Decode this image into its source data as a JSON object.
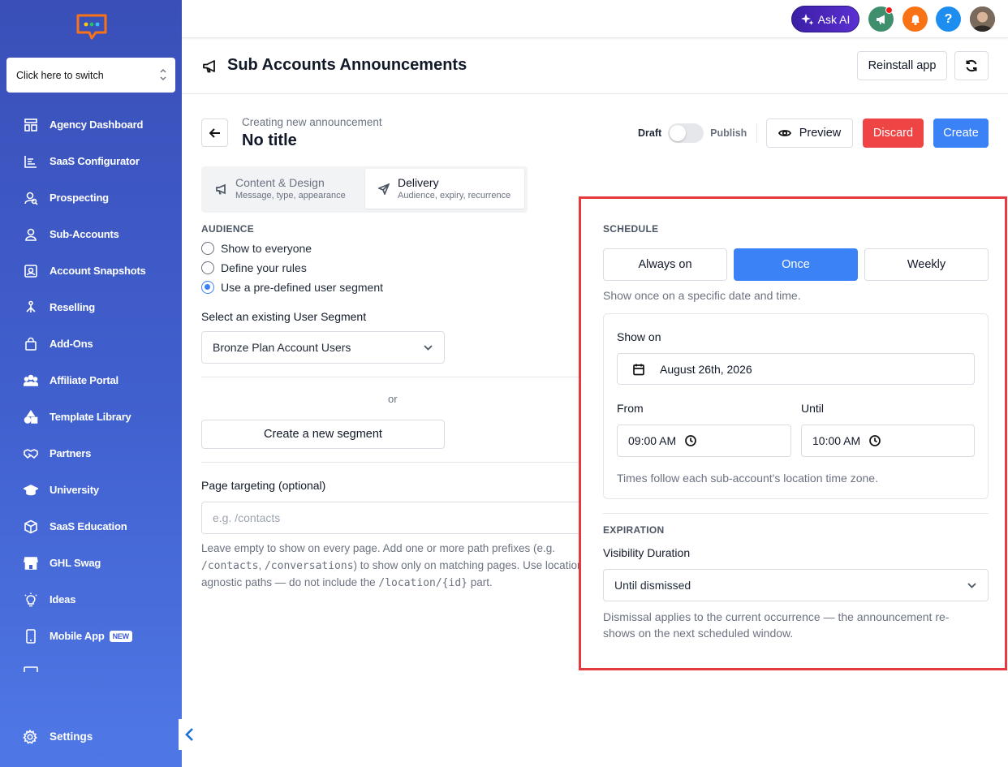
{
  "sidebar": {
    "switcher": "Click here to switch",
    "items": [
      {
        "label": "Agency Dashboard",
        "icon": "dashboard-icon"
      },
      {
        "label": "SaaS Configurator",
        "icon": "chart-icon"
      },
      {
        "label": "Prospecting",
        "icon": "prospecting-icon"
      },
      {
        "label": "Sub-Accounts",
        "icon": "user-icon"
      },
      {
        "label": "Account Snapshots",
        "icon": "snapshot-icon"
      },
      {
        "label": "Reselling",
        "icon": "reselling-icon"
      },
      {
        "label": "Add-Ons",
        "icon": "bag-icon"
      },
      {
        "label": "Affiliate Portal",
        "icon": "users-icon"
      },
      {
        "label": "Template Library",
        "icon": "shapes-icon"
      },
      {
        "label": "Partners",
        "icon": "handshake-icon"
      },
      {
        "label": "University",
        "icon": "graduation-icon"
      },
      {
        "label": "SaaS Education",
        "icon": "cube-icon"
      },
      {
        "label": "GHL Swag",
        "icon": "store-icon"
      },
      {
        "label": "Ideas",
        "icon": "bulb-icon"
      },
      {
        "label": "Mobile App",
        "icon": "mobile-icon",
        "badge": "NEW"
      }
    ],
    "settings": "Settings"
  },
  "topbar": {
    "ask_ai": "Ask AI",
    "help": "?"
  },
  "page": {
    "title": "Sub Accounts Announcements",
    "reinstall": "Reinstall app"
  },
  "editor": {
    "subtitle": "Creating new announcement",
    "title": "No title",
    "draft": "Draft",
    "publish": "Publish",
    "preview": "Preview",
    "discard": "Discard",
    "create": "Create"
  },
  "tabs": [
    {
      "label": "Content & Design",
      "sub": "Message, type, appearance"
    },
    {
      "label": "Delivery",
      "sub": "Audience, expiry, recurrence"
    }
  ],
  "audience": {
    "label": "AUDIENCE",
    "options": [
      "Show to everyone",
      "Define your rules",
      "Use a pre-defined user segment"
    ],
    "selected_index": 2,
    "segment_label": "Select an existing User Segment",
    "segment_value": "Bronze Plan Account Users",
    "or": "or",
    "new_segment": "Create a new segment"
  },
  "targeting": {
    "label": "Page targeting (optional)",
    "placeholder": "e.g. /contacts",
    "help_1": "Leave empty to show on every page. Add one or more path prefixes (e.g.",
    "code_1": "/contacts",
    "sep": ", ",
    "code_2": "/conversations",
    "help_2": ") to show only on matching pages. Use location-agnostic paths — do not include the ",
    "code_3": "/location/{id}",
    "help_3": " part."
  },
  "schedule": {
    "label": "SCHEDULE",
    "options": [
      "Always on",
      "Once",
      "Weekly"
    ],
    "selected": "Once",
    "description": "Show once on a specific date and time.",
    "show_on_label": "Show on",
    "date": "August 26th, 2026",
    "from_label": "From",
    "from": "09:00 AM",
    "until_label": "Until",
    "until": "10:00 AM",
    "tz_note": "Times follow each sub-account's location time zone."
  },
  "expiration": {
    "label": "EXPIRATION",
    "visibility_label": "Visibility Duration",
    "visibility_value": "Until dismissed",
    "note": "Dismissal applies to the current occurrence — the announcement re-shows on the next scheduled window."
  },
  "colors": {
    "primary": "#3b82f6",
    "danger": "#ef4444",
    "highlight": "#e5393e",
    "sidebar": "#4161cf"
  }
}
